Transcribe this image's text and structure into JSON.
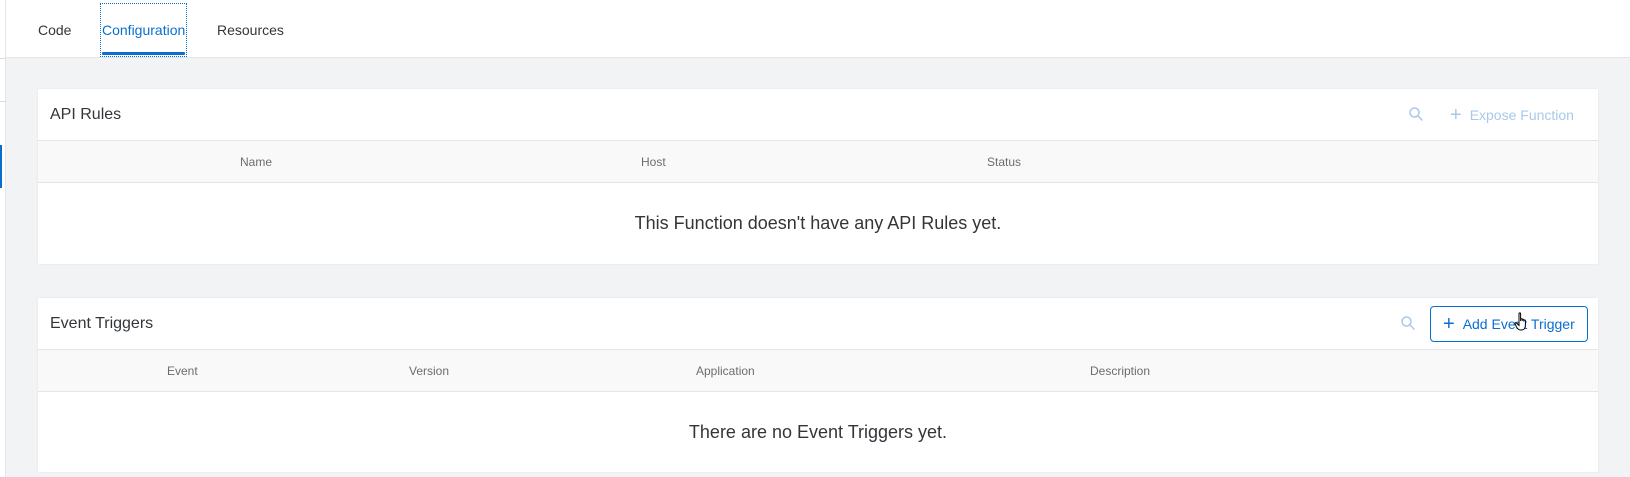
{
  "tabs": [
    {
      "label": "Code"
    },
    {
      "label": "Configuration"
    },
    {
      "label": "Resources"
    }
  ],
  "api_rules": {
    "title": "API Rules",
    "action_label": "Expose Function",
    "columns": [
      "Name",
      "Host",
      "Status"
    ],
    "empty_message": "This Function doesn't have any API Rules yet."
  },
  "event_triggers": {
    "title": "Event Triggers",
    "action_label": "Add Event Trigger",
    "columns": [
      "Event",
      "Version",
      "Application",
      "Description"
    ],
    "empty_message": "There are no Event Triggers yet."
  },
  "icons": {
    "search": "search-icon",
    "plus": "plus-icon",
    "cursor": "hand-cursor-icon"
  },
  "colors": {
    "accent": "#0a6ed1",
    "accent_disabled": "#a9c9ea",
    "background": "#f2f3f5"
  }
}
